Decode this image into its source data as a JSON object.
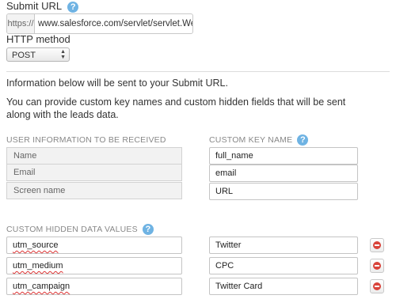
{
  "submit_url": {
    "label": "Submit URL",
    "help_icon": "question-help-icon",
    "prefix": "https://",
    "value": "www.salesforce.com/servlet/servlet.WebToLead?"
  },
  "http_method": {
    "label": "HTTP method",
    "selected": "POST",
    "icon": "updown-arrows-icon"
  },
  "info": {
    "line1": "Information below will be sent to your Submit URL.",
    "line2a": "You can provide custom key names and custom hidden fields that will be sent",
    "line2b": "along with the leads data."
  },
  "user_info": {
    "header": "USER INFORMATION TO BE RECEIVED",
    "rows": [
      "Name",
      "Email",
      "Screen name"
    ]
  },
  "custom_key": {
    "header": "CUSTOM KEY NAME",
    "values": [
      "full_name",
      "email",
      "URL"
    ]
  },
  "hidden": {
    "header": "CUSTOM HIDDEN DATA VALUES",
    "keys": [
      "utm_source",
      "utm_medium",
      "utm_campaign"
    ],
    "values": [
      "Twitter",
      "CPC",
      "Twitter Card"
    ],
    "delete_icon": "remove-circle-icon",
    "delete_color": "#d9443b"
  },
  "colors": {
    "help_icon": "#6fb3e3",
    "section_header": "#888888"
  }
}
